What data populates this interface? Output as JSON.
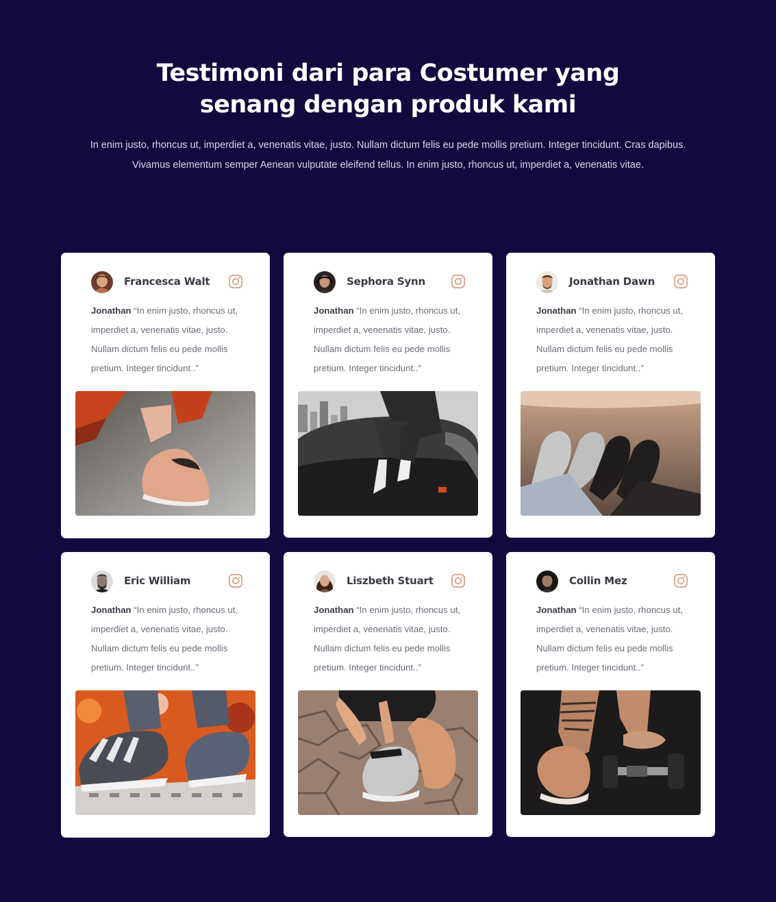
{
  "section": {
    "title_line1": "Testimoni dari para Costumer yang",
    "title_line2": "senang dengan produk kami",
    "intro": "In enim justo, rhoncus ut, imperdiet a, venenatis vitae, justo. Nullam dictum felis eu pede mollis pretium. Integer tincidunt. Cras dapibus. Vivamus elementum semper Aenean vulputate eleifend tellus. In enim justo, rhoncus ut, imperdiet a, venenatis vitae."
  },
  "colors": {
    "background": "#120a3f",
    "card": "#ffffff",
    "instagram_icon": "#d9a48a",
    "title": "#ffffff"
  },
  "testimonials": [
    {
      "name": "Francesca Walt",
      "author": "Jonathan",
      "quote": " “In enim justo, rhoncus ut, imperdiet a, venenatis vitae, justo. Nullam dictum felis eu pede mollis pretium. Integer tincidunt..”",
      "icon": "instagram-icon"
    },
    {
      "name": "Sephora Synn",
      "author": "Jonathan",
      "quote": " “In enim justo, rhoncus ut, imperdiet a, venenatis vitae, justo. Nullam dictum felis eu pede mollis pretium. Integer tincidunt..”",
      "icon": "instagram-icon"
    },
    {
      "name": "Jonathan Dawn",
      "author": "Jonathan",
      "quote": " “In enim justo, rhoncus ut, imperdiet a, venenatis vitae, justo. Nullam dictum felis eu pede mollis pretium. Integer tincidunt..”",
      "icon": "instagram-icon"
    },
    {
      "name": "Eric William",
      "author": "Jonathan",
      "quote": " “In enim justo, rhoncus ut, imperdiet a, venenatis vitae, justo. Nullam dictum felis eu pede mollis pretium. Integer tincidunt..”",
      "icon": "instagram-icon"
    },
    {
      "name": "Liszbeth Stuart",
      "author": "Jonathan",
      "quote": " “In enim justo, rhoncus ut, imperdiet a, venenatis vitae, justo. Nullam dictum felis eu pede mollis pretium. Integer tincidunt..”",
      "icon": "instagram-icon"
    },
    {
      "name": "Collin Mez",
      "author": "Jonathan",
      "quote": " “In enim justo, rhoncus ut, imperdiet a, venenatis vitae, justo. Nullam dictum felis eu pede mollis pretium. Integer tincidunt..”",
      "icon": "instagram-icon"
    }
  ]
}
